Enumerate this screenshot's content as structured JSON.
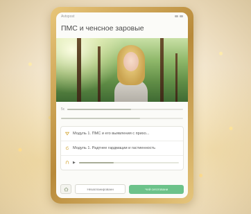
{
  "app": {
    "status_left": "Avtopost",
    "title": "ПМС и ченсное заровые"
  },
  "video": {
    "time_label": "5с",
    "progress": 0.55,
    "buffer": 0.65
  },
  "modules": [
    {
      "icon": "module-icon",
      "label": "Модуль 1. ПМС и его выявления с прихо..."
    },
    {
      "icon": "refresh-icon",
      "label": "Модуль 1. Радтнее гардмации и гастиенность"
    },
    {
      "icon": "audio-icon",
      "label": "",
      "progress": 0.35
    }
  ],
  "footer": {
    "secondary_label": "Незапланированн",
    "primary_label": "Чей сеготовани"
  },
  "colors": {
    "accent_green": "#6cc28a",
    "frame_gold": "#c9a04f"
  }
}
